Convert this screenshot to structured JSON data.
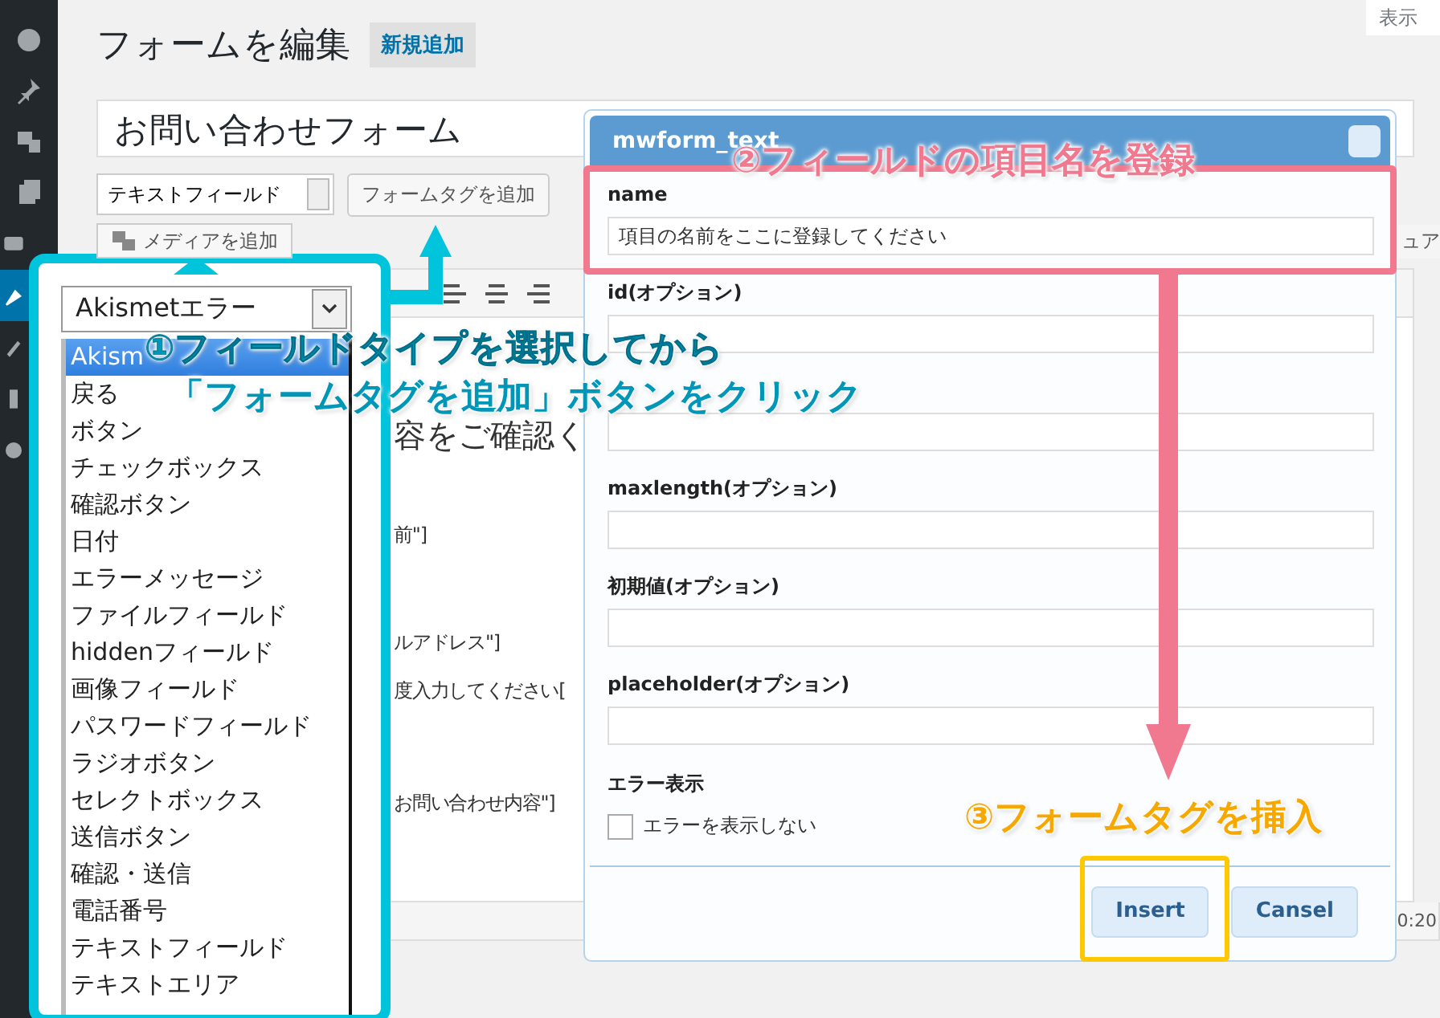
{
  "sidebar_items": [
    {
      "selected": false
    },
    {
      "selected": false
    },
    {
      "selected": false
    },
    {
      "selected": false
    },
    {
      "selected": false
    },
    {
      "selected": true
    },
    {
      "selected": false
    },
    {
      "selected": false
    },
    {
      "selected": false
    }
  ],
  "header": {
    "title": "フォームを編集",
    "add_new": "新規追加",
    "screen_options": "表示"
  },
  "form_title": "お問い合わせフォーム",
  "field_type_select": "テキストフィールド",
  "add_tag_button": "フォームタグを追加",
  "media_button": "メディアを追加",
  "visual_tab": "ュア",
  "editor_lines": [
    {
      "kind": "heading",
      "text": "容をご確認く"
    },
    {
      "kind": "text",
      "text": "前\"]"
    },
    {
      "kind": "text",
      "text": "ルアドレス\"]"
    },
    {
      "kind": "text",
      "text": "度入力してください["
    },
    {
      "kind": "text",
      "text": "お問い合わせ内容\"]"
    }
  ],
  "footer_time": "0:20",
  "callout": {
    "select_value": "Akismetエラー",
    "options": [
      {
        "label": "Akism",
        "selected": true
      },
      {
        "label": "戻る",
        "selected": false
      },
      {
        "label": "ボタン",
        "selected": false
      },
      {
        "label": "チェックボックス",
        "selected": false
      },
      {
        "label": "確認ボタン",
        "selected": false
      },
      {
        "label": "日付",
        "selected": false
      },
      {
        "label": "エラーメッセージ",
        "selected": false
      },
      {
        "label": "ファイルフィールド",
        "selected": false
      },
      {
        "label": "hiddenフィールド",
        "selected": false
      },
      {
        "label": "画像フィールド",
        "selected": false
      },
      {
        "label": "パスワードフィールド",
        "selected": false
      },
      {
        "label": "ラジオボタン",
        "selected": false
      },
      {
        "label": "セレクトボックス",
        "selected": false
      },
      {
        "label": "送信ボタン",
        "selected": false
      },
      {
        "label": "確認・送信",
        "selected": false
      },
      {
        "label": "電話番号",
        "selected": false
      },
      {
        "label": "テキストフィールド",
        "selected": false
      },
      {
        "label": "テキストエリア",
        "selected": false
      }
    ]
  },
  "dialog": {
    "title": "mwform_text",
    "fields": [
      {
        "kind": "labeled",
        "label": "name",
        "value": "項目の名前をここに登録してください"
      },
      {
        "kind": "labeled",
        "label": "id(オプション)"
      },
      {
        "kind": "unlabeled"
      },
      {
        "kind": "labeled",
        "label": "maxlength(オプション)"
      },
      {
        "kind": "labeled",
        "label": "初期値(オプション)"
      },
      {
        "kind": "labeled",
        "label": "placeholder(オプション)"
      }
    ],
    "error_display": {
      "label": "エラー表示",
      "checkbox_label": "エラーを表示しない",
      "checked": false
    },
    "buttons": [
      "Insert",
      "Cansel"
    ]
  },
  "annotations": [
    {
      "lines": [
        "①フィールドタイプを選択してから",
        "「フォームタグを追加」ボタンをクリック"
      ],
      "color": "#0096b8"
    },
    {
      "lines": [
        "②フィールドの項目名を登録"
      ],
      "color": "#f0788f"
    },
    {
      "lines": [
        "③フォームタグを挿入"
      ],
      "color": "#f7a800"
    }
  ]
}
